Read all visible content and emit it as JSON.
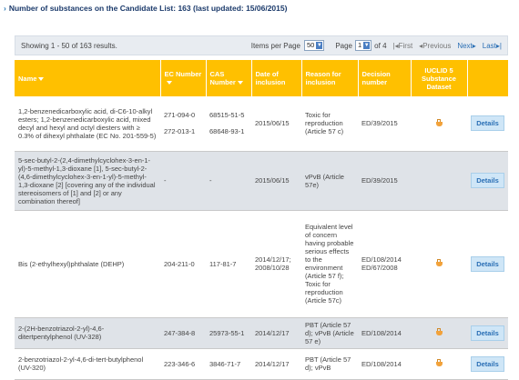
{
  "header": {
    "title": "Number of substances on the Candidate List: 163 (last updated: 15/06/2015)"
  },
  "pager": {
    "results_text": "Showing 1 - 50 of 163 results.",
    "items_per_page_label": "Items per Page",
    "items_per_page_value": "50",
    "page_label": "Page",
    "page_value": "1",
    "of_pages": "of 4",
    "first": "First",
    "previous": "Previous",
    "next": "Next",
    "last": "Last"
  },
  "table": {
    "columns": {
      "name": "Name",
      "ec": "EC Number",
      "cas": "CAS Number",
      "date": "Date of inclusion",
      "reason": "Reason for inclusion",
      "decision": "Decision number",
      "iuclid": "IUCLID 5 Substance Dataset"
    },
    "details_label": "Details",
    "rows": [
      {
        "name": "1,2-benzenedicarboxylic acid, di-C6-10-alkyl esters; 1,2-benzenedicarboxylic acid, mixed decyl and hexyl and octyl diesters with ≥ 0.3% of dihexyl phthalate (EC No. 201-559-5)",
        "ec": "271-094-0\n\n272-013-1",
        "cas": "68515-51-5\n\n68648-93-1",
        "date": "2015/06/15",
        "reason": "Toxic for reproduction (Article 57 c)",
        "decision": "ED/39/2015"
      },
      {
        "name": "5-sec-butyl-2-(2,4-dimethylcyclohex-3-en-1-yl)-5-methyl-1,3-dioxane [1], 5-sec-butyl-2-(4,6-dimethylcyclohex-3-en-1-yl)-5-methyl-1,3-dioxane [2] [covering any of the individual stereoisomers of [1] and [2] or any combination thereof]",
        "ec": "-",
        "cas": "-",
        "date": "2015/06/15",
        "reason": "vPvB (Article 57e)",
        "decision": "ED/39/2015"
      },
      {
        "name": "Bis (2-ethylhexyl)phthalate (DEHP)",
        "ec": "204-211-0",
        "cas": "117-81-7",
        "date": "2014/12/17; 2008/10/28",
        "reason": "Equivalent level of concern having probable serious effects to the environment (Article 57 f); Toxic for reproduction (Article 57c)",
        "decision": "ED/108/2014\nED/67/2008"
      },
      {
        "name": "2-(2H-benzotriazol-2-yl)-4,6-ditertpentylphenol (UV-328)",
        "ec": "247-384-8",
        "cas": "25973-55-1",
        "date": "2014/12/17",
        "reason": "PBT (Article 57 d); vPvB (Article 57 e)",
        "decision": "ED/108/2014"
      },
      {
        "name": "2-benzotriazol-2-yl-4,6-di-tert-butylphenol (UV-320)",
        "ec": "223-346-6",
        "cas": "3846-71-7",
        "date": "2014/12/17",
        "reason": "PBT (Article 57 d); vPvB",
        "decision": "ED/108/2014"
      }
    ]
  }
}
